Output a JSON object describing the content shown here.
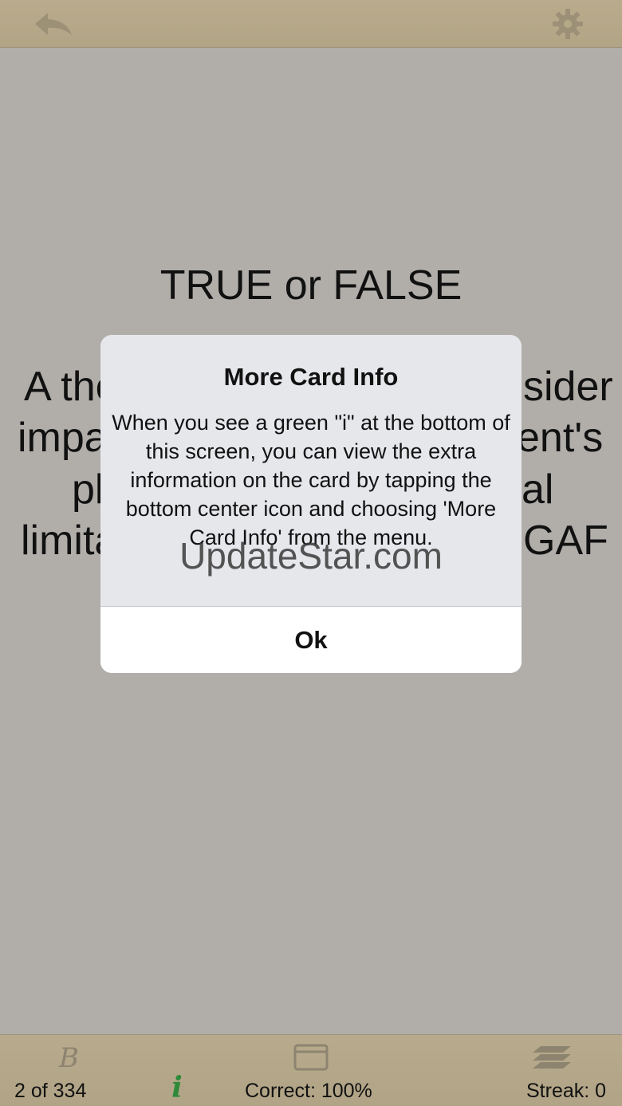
{
  "topbar": {
    "back_icon": "back-arrow-icon",
    "settings_icon": "gear-icon"
  },
  "card": {
    "title": "TRUE or FALSE",
    "visible_fragments": [
      "A the",
      "sider",
      "impa",
      "ent's",
      "pl",
      "al",
      "limita",
      "GAF"
    ]
  },
  "alert": {
    "title": "More Card Info",
    "message": "When you see a green \"i\" at the bottom of this screen, you can view the extra information on the card by tapping the bottom center icon and choosing 'More Card Info' from the menu.",
    "ok_label": "Ok"
  },
  "watermark": "UpdateStar.com",
  "bottombar": {
    "left_icon": "b-script-icon",
    "center_icon": "card-icon",
    "right_icon": "stack-icon",
    "progress": "2 of 334",
    "info_glyph": "i",
    "correct": "Correct: 100%",
    "streak": "Streak: 0"
  },
  "colors": {
    "background": "#b1aeaa",
    "bar": "#b5a889",
    "info_green": "#2e8a3a",
    "dialog": "#e6e7eb"
  }
}
